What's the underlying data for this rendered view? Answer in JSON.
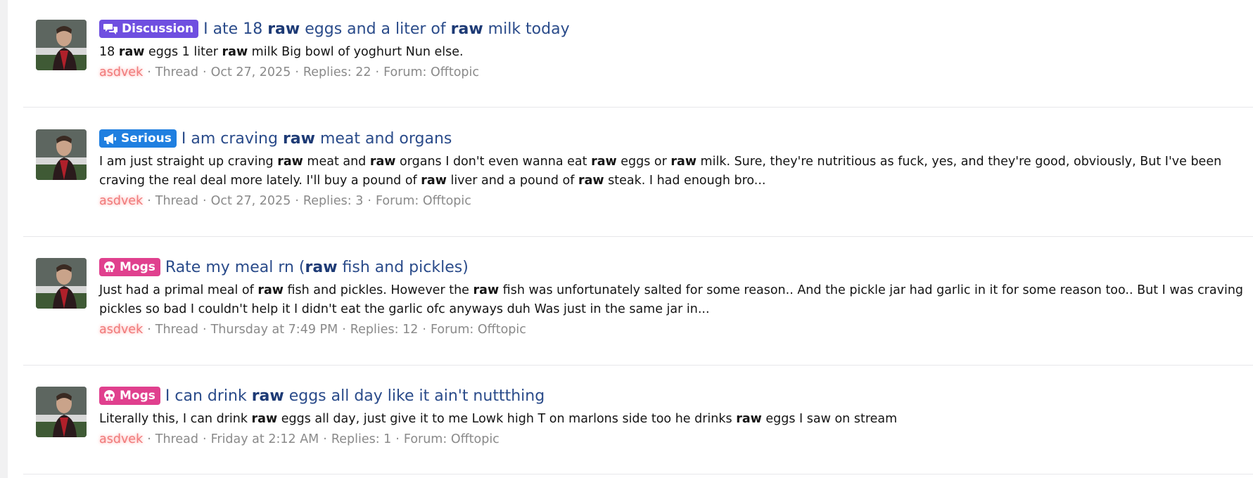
{
  "results": [
    {
      "label": "Discussion",
      "label_icon": "comments-icon",
      "label_color": "#6f4fe0",
      "title_parts": [
        {
          "t": "I ate 18 ",
          "b": false
        },
        {
          "t": "raw",
          "b": true
        },
        {
          "t": " eggs and a liter of ",
          "b": false
        },
        {
          "t": "raw",
          "b": true
        },
        {
          "t": " milk today",
          "b": false
        }
      ],
      "snippet_parts": [
        {
          "t": "18 ",
          "b": false
        },
        {
          "t": "raw",
          "b": true
        },
        {
          "t": " eggs 1 liter ",
          "b": false
        },
        {
          "t": "raw",
          "b": true
        },
        {
          "t": " milk Big bowl of yoghurt Nun else.",
          "b": false
        }
      ],
      "user": "asdvek",
      "type": "Thread",
      "date": "Oct 27, 2025",
      "replies": "Replies: 22",
      "forum": "Forum: Offtopic"
    },
    {
      "label": "Serious",
      "label_icon": "megaphone-icon",
      "label_color": "#1f7fe0",
      "title_parts": [
        {
          "t": "I am craving ",
          "b": false
        },
        {
          "t": "raw",
          "b": true
        },
        {
          "t": " meat and organs",
          "b": false
        }
      ],
      "snippet_parts": [
        {
          "t": "I am just straight up craving ",
          "b": false
        },
        {
          "t": "raw",
          "b": true
        },
        {
          "t": " meat and ",
          "b": false
        },
        {
          "t": "raw",
          "b": true
        },
        {
          "t": " organs I don't even wanna eat ",
          "b": false
        },
        {
          "t": "raw",
          "b": true
        },
        {
          "t": " eggs or ",
          "b": false
        },
        {
          "t": "raw",
          "b": true
        },
        {
          "t": " milk. Sure, they're nutritious as fuck, yes, and they're good, obviously, But I've been craving the real deal more lately. I'll buy a pound of ",
          "b": false
        },
        {
          "t": "raw",
          "b": true
        },
        {
          "t": " liver and a pound of ",
          "b": false
        },
        {
          "t": "raw",
          "b": true
        },
        {
          "t": " steak. I had enough bro...",
          "b": false
        }
      ],
      "user": "asdvek",
      "type": "Thread",
      "date": "Oct 27, 2025",
      "replies": "Replies: 3",
      "forum": "Forum: Offtopic"
    },
    {
      "label": "Mogs",
      "label_icon": "skull-icon",
      "label_color": "#e0408e",
      "title_parts": [
        {
          "t": "Rate my meal rn (",
          "b": false
        },
        {
          "t": "raw",
          "b": true
        },
        {
          "t": " fish and pickles)",
          "b": false
        }
      ],
      "snippet_parts": [
        {
          "t": "Just had a primal meal of ",
          "b": false
        },
        {
          "t": "raw",
          "b": true
        },
        {
          "t": " fish and pickles. However the ",
          "b": false
        },
        {
          "t": "raw",
          "b": true
        },
        {
          "t": " fish was unfortunately salted for some reason.. And the pickle jar had garlic in it for some reason too.. But I was craving pickles so bad I couldn't help it I didn't eat the garlic ofc anyways duh Was just in the same jar in...",
          "b": false
        }
      ],
      "user": "asdvek",
      "type": "Thread",
      "date": "Thursday at 7:49 PM",
      "replies": "Replies: 12",
      "forum": "Forum: Offtopic"
    },
    {
      "label": "Mogs",
      "label_icon": "skull-icon",
      "label_color": "#e0408e",
      "title_parts": [
        {
          "t": "I can drink ",
          "b": false
        },
        {
          "t": "raw",
          "b": true
        },
        {
          "t": " eggs all day like it ain't nuttthing",
          "b": false
        }
      ],
      "snippet_parts": [
        {
          "t": "Literally this, I can drink ",
          "b": false
        },
        {
          "t": "raw",
          "b": true
        },
        {
          "t": " eggs all day, just give it to me Lowk high T on marlons side too he drinks ",
          "b": false
        },
        {
          "t": "raw",
          "b": true
        },
        {
          "t": " eggs I saw on stream",
          "b": false
        }
      ],
      "user": "asdvek",
      "type": "Thread",
      "date": "Friday at 2:12 AM",
      "replies": "Replies: 1",
      "forum": "Forum: Offtopic"
    }
  ]
}
